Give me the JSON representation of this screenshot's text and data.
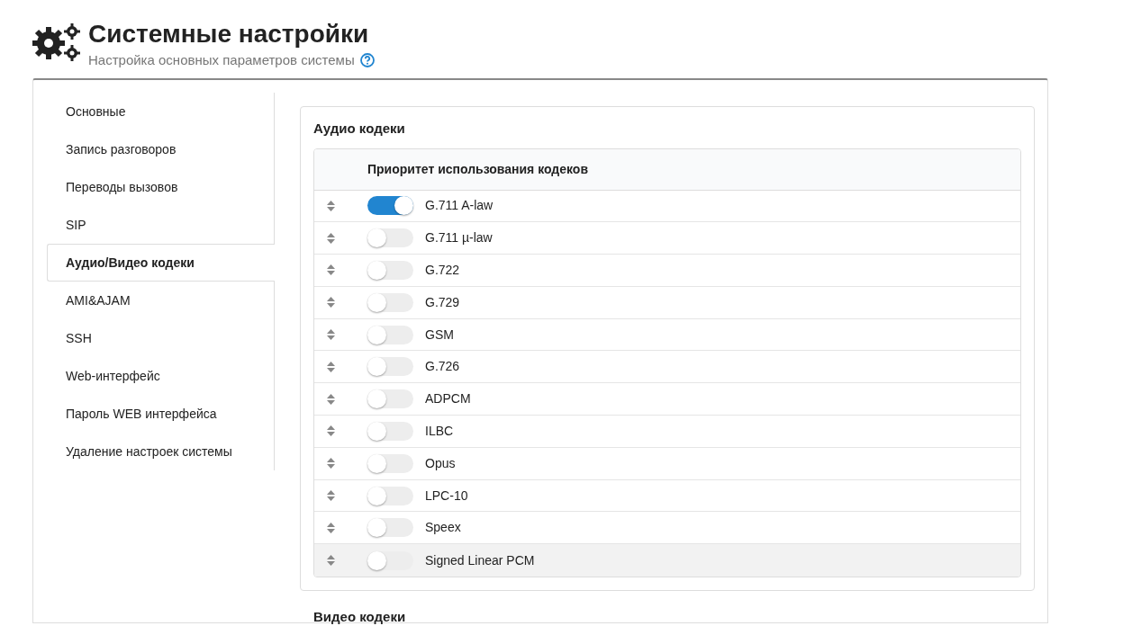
{
  "header": {
    "title": "Системные настройки",
    "subtitle": "Настройка основных параметров системы"
  },
  "sidebar": {
    "items": [
      {
        "label": "Основные",
        "selected": false
      },
      {
        "label": "Запись разговоров",
        "selected": false
      },
      {
        "label": "Переводы вызовов",
        "selected": false
      },
      {
        "label": "SIP",
        "selected": false
      },
      {
        "label": "Аудио/Видео кодеки",
        "selected": true
      },
      {
        "label": "AMI&AJAM",
        "selected": false
      },
      {
        "label": "SSH",
        "selected": false
      },
      {
        "label": "Web-интерфейс",
        "selected": false
      },
      {
        "label": "Пароль WEB интерфейса",
        "selected": false
      },
      {
        "label": "Удаление настроек системы",
        "selected": false
      }
    ]
  },
  "audio": {
    "title": "Аудио кодеки",
    "column": "Приоритет использования кодеков",
    "rows": [
      {
        "name": "G.711 A-law",
        "on": true,
        "highlighted": false
      },
      {
        "name": "G.711 µ-law",
        "on": false,
        "highlighted": false
      },
      {
        "name": "G.722",
        "on": false,
        "highlighted": false
      },
      {
        "name": "G.729",
        "on": false,
        "highlighted": false
      },
      {
        "name": "GSM",
        "on": false,
        "highlighted": false
      },
      {
        "name": "G.726",
        "on": false,
        "highlighted": false
      },
      {
        "name": "ADPCM",
        "on": false,
        "highlighted": false
      },
      {
        "name": "ILBC",
        "on": false,
        "highlighted": false
      },
      {
        "name": "Opus",
        "on": false,
        "highlighted": false
      },
      {
        "name": "LPC-10",
        "on": false,
        "highlighted": false
      },
      {
        "name": "Speex",
        "on": false,
        "highlighted": false
      },
      {
        "name": "Signed Linear PCM",
        "on": false,
        "highlighted": true
      }
    ]
  },
  "video": {
    "title": "Видео кодеки"
  }
}
